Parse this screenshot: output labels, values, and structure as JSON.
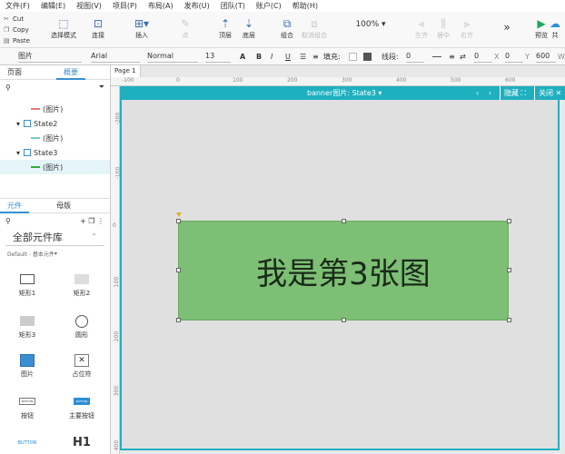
{
  "menubar": [
    "文件(F)",
    "编辑(E)",
    "视图(V)",
    "项目(P)",
    "布局(A)",
    "发布(U)",
    "团队(T)",
    "账户(C)",
    "帮助(H)"
  ],
  "clipboard": {
    "cut": "Cut",
    "copy": "Copy",
    "paste": "Paste"
  },
  "toolbar": {
    "select_mode": "选择模式",
    "connect": "连接",
    "insert": "插入",
    "point": "点",
    "top": "顶层",
    "bottom": "底层",
    "group": "组合",
    "ungroup": "取消组合",
    "zoom": "100%",
    "align_left": "左齐",
    "align_center": "居中",
    "align_right": "右齐",
    "more": "»",
    "preview": "预览",
    "share": "共"
  },
  "format": {
    "element_type": "图片",
    "font": "Arial",
    "weight": "Normal",
    "size": "13",
    "fill_label": "填充:",
    "line_label": "线段:",
    "line_value": "0",
    "x": "0",
    "y": "0",
    "w": "600",
    "x_label": "X",
    "y_label": "Y",
    "w_label": "W"
  },
  "left": {
    "tabs": [
      "页面",
      "概要"
    ],
    "outline": [
      {
        "label": "(图片)",
        "indent": 2
      },
      {
        "label": "State2",
        "indent": 1
      },
      {
        "label": "(图片)",
        "indent": 2
      },
      {
        "label": "State3",
        "indent": 1
      },
      {
        "label": "(图片)",
        "indent": 2
      }
    ],
    "lib_tabs": [
      "元件",
      "母版"
    ],
    "library_title": "全部元件库",
    "library_sub": "Default - 基本元件",
    "widgets": [
      "矩形1",
      "矩形2",
      "矩形3",
      "圆形",
      "图片",
      "占位符",
      "按钮",
      "主要按钮",
      "",
      "H1"
    ],
    "widget_button_text": "BUTTON"
  },
  "canvas": {
    "page_tab": "Page 1",
    "title": "banner图片: State3",
    "hide_label": "隐藏",
    "close_label": "关闭",
    "box_text": "我是第3张图",
    "ruler_h": [
      "-100",
      "0",
      "100",
      "200",
      "300",
      "400",
      "500",
      "600"
    ],
    "ruler_v": [
      "-200",
      "-100",
      "0",
      "100",
      "200",
      "300",
      "400"
    ]
  }
}
